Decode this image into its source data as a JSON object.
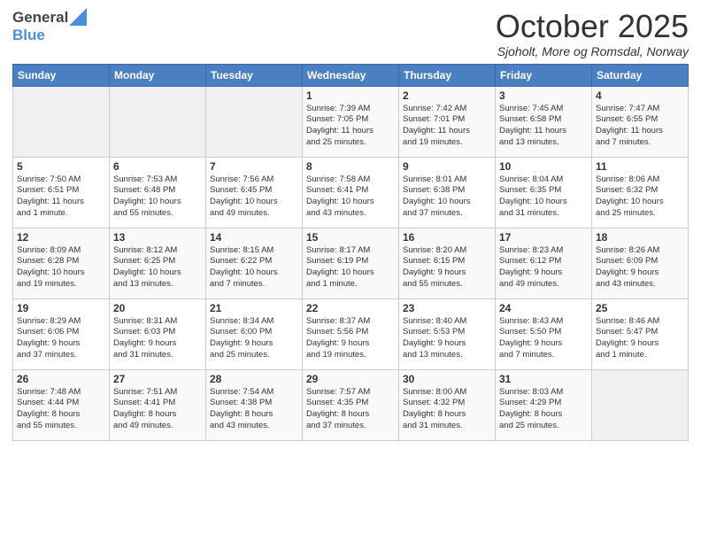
{
  "header": {
    "logo_general": "General",
    "logo_blue": "Blue",
    "month_title": "October 2025",
    "location": "Sjoholt, More og Romsdal, Norway"
  },
  "days_of_week": [
    "Sunday",
    "Monday",
    "Tuesday",
    "Wednesday",
    "Thursday",
    "Friday",
    "Saturday"
  ],
  "weeks": [
    [
      {
        "day": "",
        "info": ""
      },
      {
        "day": "",
        "info": ""
      },
      {
        "day": "",
        "info": ""
      },
      {
        "day": "1",
        "info": "Sunrise: 7:39 AM\nSunset: 7:05 PM\nDaylight: 11 hours\nand 25 minutes."
      },
      {
        "day": "2",
        "info": "Sunrise: 7:42 AM\nSunset: 7:01 PM\nDaylight: 11 hours\nand 19 minutes."
      },
      {
        "day": "3",
        "info": "Sunrise: 7:45 AM\nSunset: 6:58 PM\nDaylight: 11 hours\nand 13 minutes."
      },
      {
        "day": "4",
        "info": "Sunrise: 7:47 AM\nSunset: 6:55 PM\nDaylight: 11 hours\nand 7 minutes."
      }
    ],
    [
      {
        "day": "5",
        "info": "Sunrise: 7:50 AM\nSunset: 6:51 PM\nDaylight: 11 hours\nand 1 minute."
      },
      {
        "day": "6",
        "info": "Sunrise: 7:53 AM\nSunset: 6:48 PM\nDaylight: 10 hours\nand 55 minutes."
      },
      {
        "day": "7",
        "info": "Sunrise: 7:56 AM\nSunset: 6:45 PM\nDaylight: 10 hours\nand 49 minutes."
      },
      {
        "day": "8",
        "info": "Sunrise: 7:58 AM\nSunset: 6:41 PM\nDaylight: 10 hours\nand 43 minutes."
      },
      {
        "day": "9",
        "info": "Sunrise: 8:01 AM\nSunset: 6:38 PM\nDaylight: 10 hours\nand 37 minutes."
      },
      {
        "day": "10",
        "info": "Sunrise: 8:04 AM\nSunset: 6:35 PM\nDaylight: 10 hours\nand 31 minutes."
      },
      {
        "day": "11",
        "info": "Sunrise: 8:06 AM\nSunset: 6:32 PM\nDaylight: 10 hours\nand 25 minutes."
      }
    ],
    [
      {
        "day": "12",
        "info": "Sunrise: 8:09 AM\nSunset: 6:28 PM\nDaylight: 10 hours\nand 19 minutes."
      },
      {
        "day": "13",
        "info": "Sunrise: 8:12 AM\nSunset: 6:25 PM\nDaylight: 10 hours\nand 13 minutes."
      },
      {
        "day": "14",
        "info": "Sunrise: 8:15 AM\nSunset: 6:22 PM\nDaylight: 10 hours\nand 7 minutes."
      },
      {
        "day": "15",
        "info": "Sunrise: 8:17 AM\nSunset: 6:19 PM\nDaylight: 10 hours\nand 1 minute."
      },
      {
        "day": "16",
        "info": "Sunrise: 8:20 AM\nSunset: 6:15 PM\nDaylight: 9 hours\nand 55 minutes."
      },
      {
        "day": "17",
        "info": "Sunrise: 8:23 AM\nSunset: 6:12 PM\nDaylight: 9 hours\nand 49 minutes."
      },
      {
        "day": "18",
        "info": "Sunrise: 8:26 AM\nSunset: 6:09 PM\nDaylight: 9 hours\nand 43 minutes."
      }
    ],
    [
      {
        "day": "19",
        "info": "Sunrise: 8:29 AM\nSunset: 6:06 PM\nDaylight: 9 hours\nand 37 minutes."
      },
      {
        "day": "20",
        "info": "Sunrise: 8:31 AM\nSunset: 6:03 PM\nDaylight: 9 hours\nand 31 minutes."
      },
      {
        "day": "21",
        "info": "Sunrise: 8:34 AM\nSunset: 6:00 PM\nDaylight: 9 hours\nand 25 minutes."
      },
      {
        "day": "22",
        "info": "Sunrise: 8:37 AM\nSunset: 5:56 PM\nDaylight: 9 hours\nand 19 minutes."
      },
      {
        "day": "23",
        "info": "Sunrise: 8:40 AM\nSunset: 5:53 PM\nDaylight: 9 hours\nand 13 minutes."
      },
      {
        "day": "24",
        "info": "Sunrise: 8:43 AM\nSunset: 5:50 PM\nDaylight: 9 hours\nand 7 minutes."
      },
      {
        "day": "25",
        "info": "Sunrise: 8:46 AM\nSunset: 5:47 PM\nDaylight: 9 hours\nand 1 minute."
      }
    ],
    [
      {
        "day": "26",
        "info": "Sunrise: 7:48 AM\nSunset: 4:44 PM\nDaylight: 8 hours\nand 55 minutes."
      },
      {
        "day": "27",
        "info": "Sunrise: 7:51 AM\nSunset: 4:41 PM\nDaylight: 8 hours\nand 49 minutes."
      },
      {
        "day": "28",
        "info": "Sunrise: 7:54 AM\nSunset: 4:38 PM\nDaylight: 8 hours\nand 43 minutes."
      },
      {
        "day": "29",
        "info": "Sunrise: 7:57 AM\nSunset: 4:35 PM\nDaylight: 8 hours\nand 37 minutes."
      },
      {
        "day": "30",
        "info": "Sunrise: 8:00 AM\nSunset: 4:32 PM\nDaylight: 8 hours\nand 31 minutes."
      },
      {
        "day": "31",
        "info": "Sunrise: 8:03 AM\nSunset: 4:29 PM\nDaylight: 8 hours\nand 25 minutes."
      },
      {
        "day": "",
        "info": ""
      }
    ]
  ]
}
